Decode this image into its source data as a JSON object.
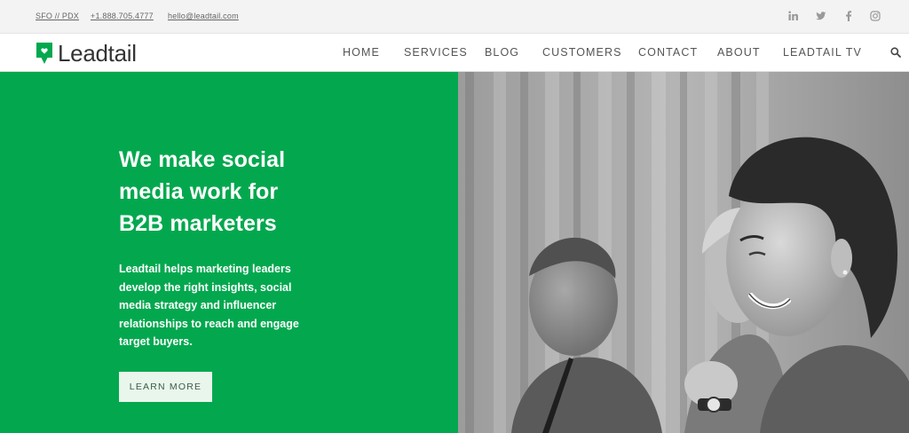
{
  "topbar": {
    "location": "SFO // PDX",
    "phone": "+1.888.705.4777",
    "email": "hello@leadtail.com",
    "social": [
      "linkedin-icon",
      "twitter-icon",
      "facebook-icon",
      "instagram-icon"
    ]
  },
  "brand": {
    "name": "Leadtail",
    "color": "#03a84e"
  },
  "nav": {
    "items": [
      "HOME",
      "SERVICES",
      "BLOG",
      "CUSTOMERS",
      "CONTACT",
      "ABOUT",
      "LEADTAIL TV"
    ],
    "search_icon": "search-icon"
  },
  "hero": {
    "headline": [
      "We make social",
      "media work for",
      "B2B marketers"
    ],
    "body": [
      "Leadtail helps marketing leaders",
      "develop the right insights, social",
      "media strategy and influencer",
      "relationships to reach and engage",
      "target buyers."
    ],
    "cta": "LEARN MORE",
    "background": "#03a84e"
  }
}
